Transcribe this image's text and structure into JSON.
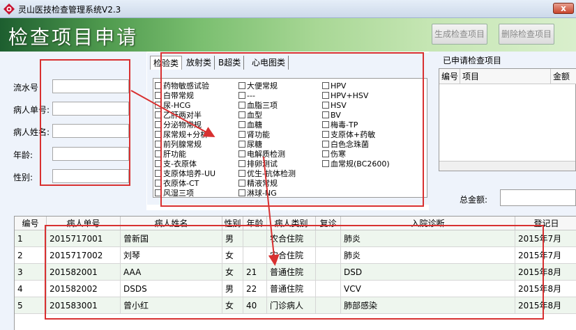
{
  "window": {
    "title": "灵山医技检查管理系统V2.3",
    "close": "x"
  },
  "header": {
    "title": "检查项目申请",
    "generate_btn": "生成检查项目",
    "delete_btn": "删除检查项目"
  },
  "form": {
    "serial_label": "流水号",
    "patient_no_label": "病人单号:",
    "patient_name_label": "病人姓名:",
    "age_label": "年龄:",
    "gender_label": "性别:"
  },
  "tabs": [
    "检验类",
    "放射类",
    "B超类",
    "心电图类"
  ],
  "check_columns": [
    [
      "药物敏感试验",
      "白带常规",
      "尿-HCG",
      "乙肝两对半",
      "分泌物常规",
      "尿常规+分析",
      "前列腺常规",
      "肝功能",
      "支-衣原体",
      "支原体培养-UU",
      "衣原体-CT",
      "风湿三项"
    ],
    [
      "大便常规",
      "---",
      "血脂三项",
      "血型",
      "血糖",
      "肾功能",
      "尿糖",
      "电解质检测",
      "排卵测试",
      "优生-抗体检测",
      "精液常规",
      "淋球-NG"
    ],
    [
      "HPV",
      "HPV+HSV",
      "HSV",
      "BV",
      "梅毒-TP",
      "支原体+药敏",
      "白色念珠菌",
      "伤寒",
      "血常规(BC2600)"
    ]
  ],
  "applied": {
    "title": "已申请检查项目",
    "cols": [
      "编号",
      "项目",
      "金额"
    ],
    "total_label": "总金额:"
  },
  "grid": {
    "headers": [
      "编号",
      "病人单号",
      "病人姓名",
      "性别",
      "年龄",
      "病人类别",
      "复诊",
      "入院诊断",
      "登记日"
    ],
    "rows": [
      [
        "1",
        "2015717001",
        "曾新国",
        "男",
        "",
        "农合住院",
        "",
        "肺炎",
        "2015年7月"
      ],
      [
        "2",
        "2015717002",
        "刘琴",
        "女",
        "",
        "农合住院",
        "",
        "肺炎",
        "2015年7月"
      ],
      [
        "3",
        "201582001",
        "AAA",
        "女",
        "21",
        "普通住院",
        "",
        "DSD",
        "2015年8月"
      ],
      [
        "4",
        "201582002",
        "DSDS",
        "男",
        "22",
        "普通住院",
        "",
        "VCV",
        "2015年8月"
      ],
      [
        "5",
        "201583001",
        "曾小红",
        "女",
        "40",
        "门诊病人",
        "",
        "肺部感染",
        "2015年8月"
      ]
    ]
  }
}
